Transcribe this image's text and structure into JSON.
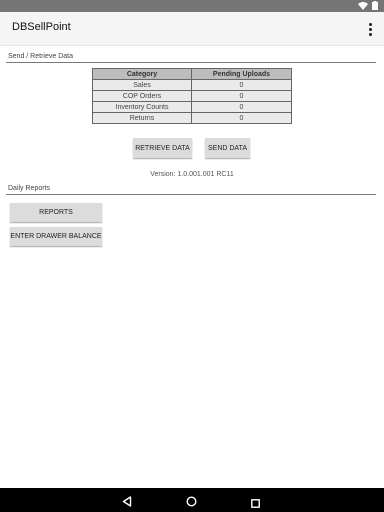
{
  "app": {
    "title": "DBSellPoint"
  },
  "sync": {
    "section_label": "Send / Retrieve Data",
    "table": {
      "headers": [
        "Category",
        "Pending Uploads"
      ],
      "rows": [
        {
          "category": "Sales",
          "pending": "0"
        },
        {
          "category": "COP Orders",
          "pending": "0"
        },
        {
          "category": "Inventory Counts",
          "pending": "0"
        },
        {
          "category": "Returns",
          "pending": "0"
        }
      ]
    },
    "retrieve_label": "RETRIEVE DATA",
    "send_label": "SEND DATA",
    "version": "Version: 1.0.001.001 RC11"
  },
  "reports": {
    "section_label": "Daily Reports",
    "reports_label": "REPORTS",
    "drawer_label": "ENTER DRAWER BALANCE"
  },
  "icons": {
    "status": [
      "wifi-icon",
      "battery-icon"
    ],
    "app_bar": [
      "overflow-menu-icon"
    ],
    "nav": [
      "back-icon",
      "home-icon",
      "recent-apps-icon"
    ]
  },
  "colors": {
    "status_bar": "#757575",
    "app_bar": "#f5f5f5",
    "table_header": "#bdbdbd",
    "table_cell": "#eaeaea",
    "button": "#dcdcdc",
    "nav_bar": "#000000"
  }
}
